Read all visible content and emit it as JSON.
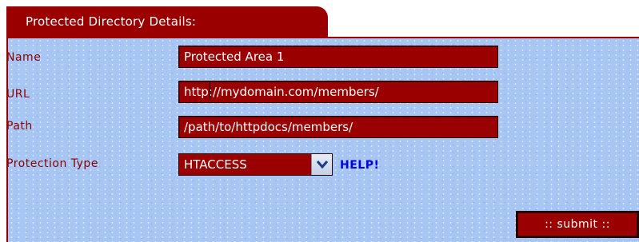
{
  "panel": {
    "title": "Protected Directory Details:"
  },
  "form": {
    "name": {
      "label": "Name",
      "value": "Protected Area 1"
    },
    "url": {
      "label": "URL",
      "value": "http://mydomain.com/members/"
    },
    "path": {
      "label": "Path",
      "value": "/path/to/httpdocs/members/"
    },
    "protection_type": {
      "label": "Protection Type",
      "value": "HTACCESS"
    },
    "help_link": "HELP!",
    "submit_label": ":: submit ::"
  },
  "icons": {
    "dropdown": "chevron-down-icon"
  },
  "colors": {
    "accent": "#9b0000",
    "panel_bg": "#a8c6f4",
    "label_text": "#8a0000",
    "link": "#0000dd"
  }
}
